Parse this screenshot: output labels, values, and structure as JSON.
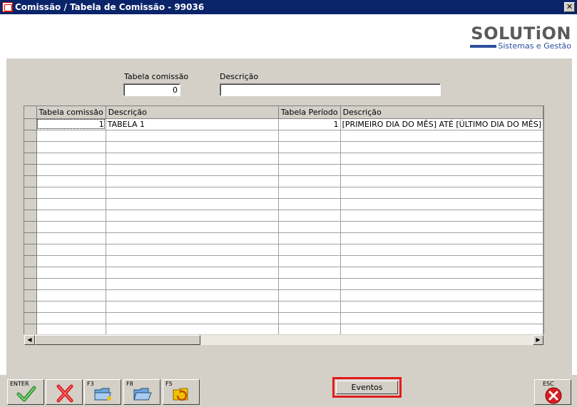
{
  "window": {
    "title": "Comissão / Tabela de Comissão - 99036",
    "close_glyph": "✕"
  },
  "logo": {
    "brand": "SOLUTiON",
    "tagline": "Sistemas e Gestão"
  },
  "filters": {
    "tabela_label": "Tabela comissão",
    "tabela_value": "0",
    "descricao_label": "Descrição",
    "descricao_value": ""
  },
  "grid": {
    "columns": [
      "Tabela comissão",
      "Descrição",
      "Tabela Período",
      "Descrição"
    ],
    "rows": [
      [
        "1",
        "TABELA 1",
        "1",
        "[PRIMEIRO DIA DO MÊS] ATÉ [ÚLTIMO DIA DO MÊS]"
      ]
    ],
    "empty_rows": 18
  },
  "toolbar": {
    "confirm_key": "ENTER",
    "confirm_icon": "check-icon",
    "cancel_icon": "x-icon",
    "f3_key": "F3",
    "f3_icon": "folder-new-icon",
    "f8_key": "F8",
    "f8_icon": "folder-open-icon",
    "f5_key": "F5",
    "f5_icon": "refresh-icon",
    "eventos_label": "Eventos",
    "esc_key": "ESC",
    "esc_icon": "close-icon"
  }
}
